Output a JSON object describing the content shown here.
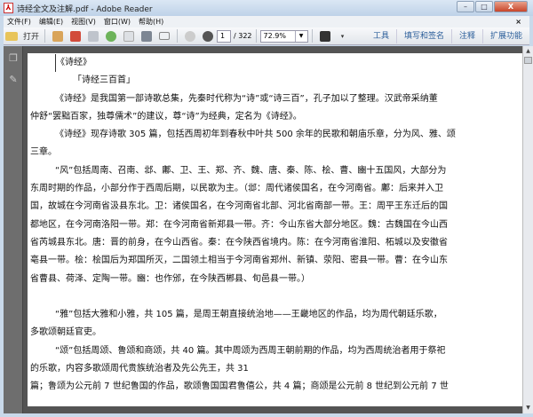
{
  "window": {
    "title": "诗经全文及注解.pdf - Adobe Reader",
    "minimize": "–",
    "maximize": "□",
    "close": "X"
  },
  "menu": [
    "文件(F)",
    "编辑(E)",
    "视图(V)",
    "窗口(W)",
    "帮助(H)"
  ],
  "menu_close": "×",
  "toolbar": {
    "open_label": "打开",
    "page_current": "1",
    "page_total": "/ 322",
    "zoom": "72.9%",
    "tools": "工具",
    "fill_sign": "填写和签名",
    "comment": "注释",
    "extended": "扩展功能"
  },
  "document": {
    "lines": [
      "《诗经》",
      "「诗经三百首」",
      "《诗经》是我国第一部诗歌总集，先秦时代称为“诗”或“诗三百”，孔子加以了整理。汉武帝采纳董",
      "仲舒“罢黜百家，独尊儒术”的建议，尊“诗”为经典，定名为《诗经》。",
      "《诗经》现存诗歌 305 篇，包括西周初年到春秋中叶共 500 余年的民歌和朝庙乐章，分为风、雅、颂",
      "三章。",
      "“风”包括周南、召南、邶、鄘、卫、王、郑、齐、魏、唐、秦、陈、桧、曹、豳十五国风，大部分为",
      "东周时期的作品，小部分作于西周后期，以民歌为主。（邶：周代诸侯国名，在今河南省。鄘：后来并入卫",
      "国，故城在今河南省汲县东北。卫：诸侯国名，在今河南省北部、河北省南部一带。王：周平王东迁后的国",
      "都地区，在今河南洛阳一带。郑：在今河南省新郑县一带。齐：今山东省大部分地区。魏：古魏国在今山西",
      "省芮城县东北。唐：晋的前身，在今山西省。秦：在今陕西省境内。陈：在今河南省淮阳、柘城以及安徽省",
      "亳县一带。桧：桧国后为郑国所灭，二国领土相当于今河南省郑州、新镇、荥阳、密县一带。曹：在今山东",
      "省曹县、荷泽、定陶一带。豳：也作邠，在今陕西郴县、旬邑县一带。）",
      "",
      "“雅”包括大雅和小雅，共 105 篇，是周王朝直接统治地——王畿地区的作品，均为周代朝廷乐歌，",
      "多歌颂朝廷官吏。",
      "“颂”包括周颂、鲁颂和商颂，共 40 篇。其中周颂为西周王朝前期的作品，均为西周统治者用于祭祀",
      "的乐歌，内容多歌颂周代贵族统治者及先公先王，共 31",
      "篇；鲁颂为公元前 7 世纪鲁国的作品，歌颂鲁国国君鲁僖公，共 4 篇；商颂是公元前 8 世纪到公元前 7 世"
    ]
  }
}
